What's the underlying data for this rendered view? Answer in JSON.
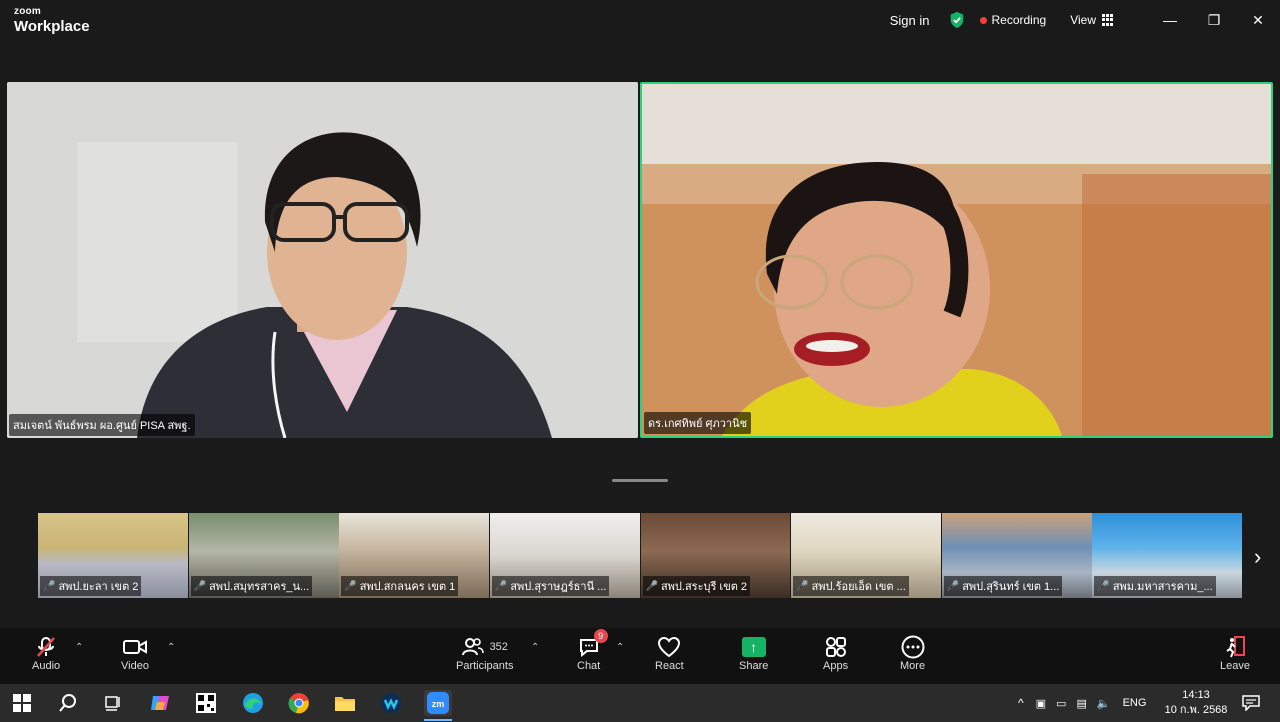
{
  "app": {
    "brand_top": "zoom",
    "brand_bottom": "Workplace"
  },
  "titlebar": {
    "sign_in": "Sign in",
    "recording": "Recording",
    "view": "View",
    "controls": {
      "minimize": "—",
      "restore": "❐",
      "close": "✕"
    }
  },
  "videos": [
    {
      "name": "สมเจตน์ พันธ์พรม ผอ.ศูนย์ PISA สพฐ."
    },
    {
      "name": "ดร.เกศทิพย์ ศุภวานิช"
    }
  ],
  "thumbnails": [
    {
      "name": "สพป.ยะลา เขต 2"
    },
    {
      "name": "สพป.สมุทรสาคร_น..."
    },
    {
      "name": "สพป.สกลนคร เขต 1"
    },
    {
      "name": "สพป.สุราษฎร์ธานี ..."
    },
    {
      "name": "สพป.สระบุรี เขต 2"
    },
    {
      "name": "สพป.ร้อยเอ็ด เขต ..."
    },
    {
      "name": "สพป.สุรินทร์ เขต 1..."
    },
    {
      "name": "สพม.มหาสารคาม_..."
    }
  ],
  "toolbar": {
    "audio": "Audio",
    "video": "Video",
    "participants": "Participants",
    "participants_count": "352",
    "chat": "Chat",
    "chat_badge": "9",
    "react": "React",
    "share": "Share",
    "apps": "Apps",
    "more": "More",
    "leave": "Leave"
  },
  "taskbar": {
    "language": "ENG",
    "time": "14:13",
    "date": "10 ก.พ. 2568"
  },
  "colors": {
    "active_speaker_border": "#2fd17a",
    "recording_dot": "#ff3b3b",
    "share_green": "#16b364",
    "badge_red": "#e5484d"
  }
}
